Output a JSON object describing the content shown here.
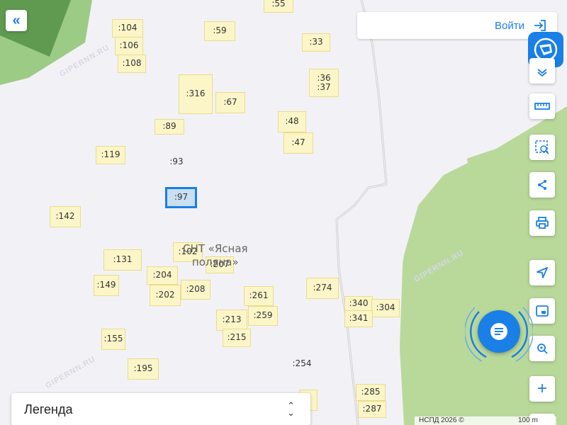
{
  "map": {
    "area_label_line1": "СНТ «Ясная",
    "area_label_line2": "поляна»",
    "watermark": "GIPERNN.RU",
    "colors": {
      "land": "#f2f2f6",
      "forest": "#b9d99b",
      "dark_forest": "#5f9a50",
      "road": "#c8c8c8",
      "plot_fill": "#fbf5c8",
      "plot_border": "#eadc8a",
      "selected": "#1a7fe6"
    },
    "plots": [
      {
        "id": "p55",
        "text": ":55"
      },
      {
        "id": "p104",
        "text": ":104"
      },
      {
        "id": "p106",
        "text": ":106"
      },
      {
        "id": "p108",
        "text": ":108"
      },
      {
        "id": "p59",
        "text": ":59"
      },
      {
        "id": "p33",
        "text": ":33"
      },
      {
        "id": "p36",
        "text": ":36\n:37"
      },
      {
        "id": "p316",
        "text": ":316"
      },
      {
        "id": "p67",
        "text": ":67"
      },
      {
        "id": "p48",
        "text": ":48"
      },
      {
        "id": "p89",
        "text": ":89"
      },
      {
        "id": "p47",
        "text": ":47"
      },
      {
        "id": "p119",
        "text": ":119"
      },
      {
        "id": "p93",
        "text": ":93"
      },
      {
        "id": "p97",
        "text": ":97"
      },
      {
        "id": "p142",
        "text": ":142"
      },
      {
        "id": "p102",
        "text": ":102"
      },
      {
        "id": "p207",
        "text": ":207"
      },
      {
        "id": "p131",
        "text": ":131"
      },
      {
        "id": "p204",
        "text": ":204"
      },
      {
        "id": "p149",
        "text": ":149"
      },
      {
        "id": "p202",
        "text": ":202"
      },
      {
        "id": "p208",
        "text": ":208"
      },
      {
        "id": "p261",
        "text": ":261"
      },
      {
        "id": "p274",
        "text": ":274"
      },
      {
        "id": "p340",
        "text": ":340"
      },
      {
        "id": "p304",
        "text": ":304"
      },
      {
        "id": "p341",
        "text": ":341"
      },
      {
        "id": "p213",
        "text": ":213"
      },
      {
        "id": "p259",
        "text": ":259"
      },
      {
        "id": "p215",
        "text": ":215"
      },
      {
        "id": "p155",
        "text": ":155"
      },
      {
        "id": "p254",
        "text": ":254"
      },
      {
        "id": "p195",
        "text": ":195"
      },
      {
        "id": "p285",
        "text": ":285"
      },
      {
        "id": "p287",
        "text": ":287"
      },
      {
        "id": "p-partial",
        "text": ")"
      }
    ]
  },
  "header": {
    "collapse_icon": "double-chevron-left-icon",
    "login_label": "Войти"
  },
  "tools": [
    {
      "name": "layers-icon"
    },
    {
      "name": "ruler-icon"
    },
    {
      "name": "select-area-icon"
    },
    {
      "name": "share-icon"
    },
    {
      "name": "print-icon"
    },
    {
      "name": "locate-icon"
    },
    {
      "name": "screen-icon"
    },
    {
      "name": "geo-search-icon"
    },
    {
      "name": "zoom-in-icon"
    }
  ],
  "legend": {
    "label": "Легенда"
  },
  "attribution": {
    "text": "НСПД 2026 ©",
    "scale": "100 m"
  }
}
